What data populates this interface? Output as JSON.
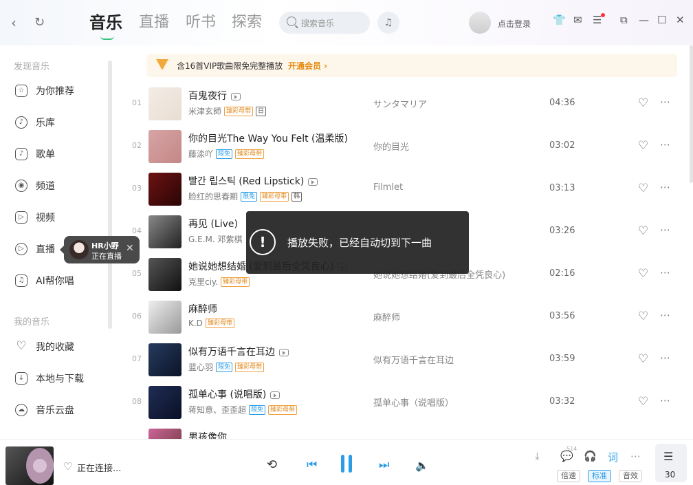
{
  "topbar": {
    "tabs": [
      "音乐",
      "直播",
      "听书",
      "探索"
    ],
    "search_placeholder": "搜索音乐",
    "login": "点击登录"
  },
  "sidebar": {
    "discover_title": "发现音乐",
    "discover": [
      "为你推荐",
      "乐库",
      "歌单",
      "频道",
      "视频",
      "直播",
      "AI帮你唱"
    ],
    "mine_title": "我的音乐",
    "mine": [
      "我的收藏",
      "本地与下载",
      "音乐云盘"
    ]
  },
  "live_popup": {
    "name": "HR小野",
    "status": "正在直播"
  },
  "vip_banner": {
    "text": "含16首VIP歌曲限免完整播放",
    "link": "开通会员 ›"
  },
  "songs": [
    {
      "num": "01",
      "title": "百鬼夜行",
      "artist": "米津玄師",
      "tags": [
        "臻彩母带",
        "日"
      ],
      "album": "サンタマリア",
      "duration": "04:36"
    },
    {
      "num": "02",
      "title": "你的目光The Way You Felt (温柔版)",
      "artist": "藤渁吖",
      "tags": [
        "限免",
        "臻彩母带"
      ],
      "album": "你的目光",
      "duration": "03:02"
    },
    {
      "num": "03",
      "title": "빨간 립스틱 (Red Lipstick)",
      "artist": "脸红的思春期",
      "tags": [
        "限免",
        "臻彩母带",
        "韩"
      ],
      "album": "Filmlet",
      "duration": "03:13"
    },
    {
      "num": "04",
      "title": "再见 (Live)",
      "artist": "G.E.M. 邓紫棋",
      "tags": [],
      "album": "",
      "duration": "03:26"
    },
    {
      "num": "05",
      "title": "她说她想结婚 (爱到最后全凭良心)",
      "artist": "克里ciy.",
      "tags": [
        "臻彩母带"
      ],
      "album": "她说她想结婚(爱到最后全凭良心)",
      "duration": "02:16"
    },
    {
      "num": "06",
      "title": "麻醉师",
      "artist": "K.D",
      "tags": [
        "臻彩母带"
      ],
      "album": "麻醉师",
      "duration": "03:56"
    },
    {
      "num": "07",
      "title": "似有万语千言在耳边",
      "artist": "蓝心羽",
      "tags": [
        "限免",
        "臻彩母带"
      ],
      "album": "似有万语千言在耳边",
      "duration": "03:59"
    },
    {
      "num": "08",
      "title": "孤单心事 (说唱版)",
      "artist": "蒋知意、歪歪超",
      "tags": [
        "限免",
        "臻彩母带"
      ],
      "album": "孤单心事（说唱版）",
      "duration": "03:32"
    },
    {
      "num": "",
      "title": "男孩像你",
      "artist": "",
      "tags": [],
      "album": "",
      "duration": ""
    }
  ],
  "toast": {
    "text": "播放失败，已经自动切到下一曲"
  },
  "player": {
    "status": "正在连接...",
    "comment_count": "514",
    "lyrics_label": "词",
    "buttons": [
      "倍速",
      "标准",
      "音效"
    ],
    "queue_count": "30"
  }
}
